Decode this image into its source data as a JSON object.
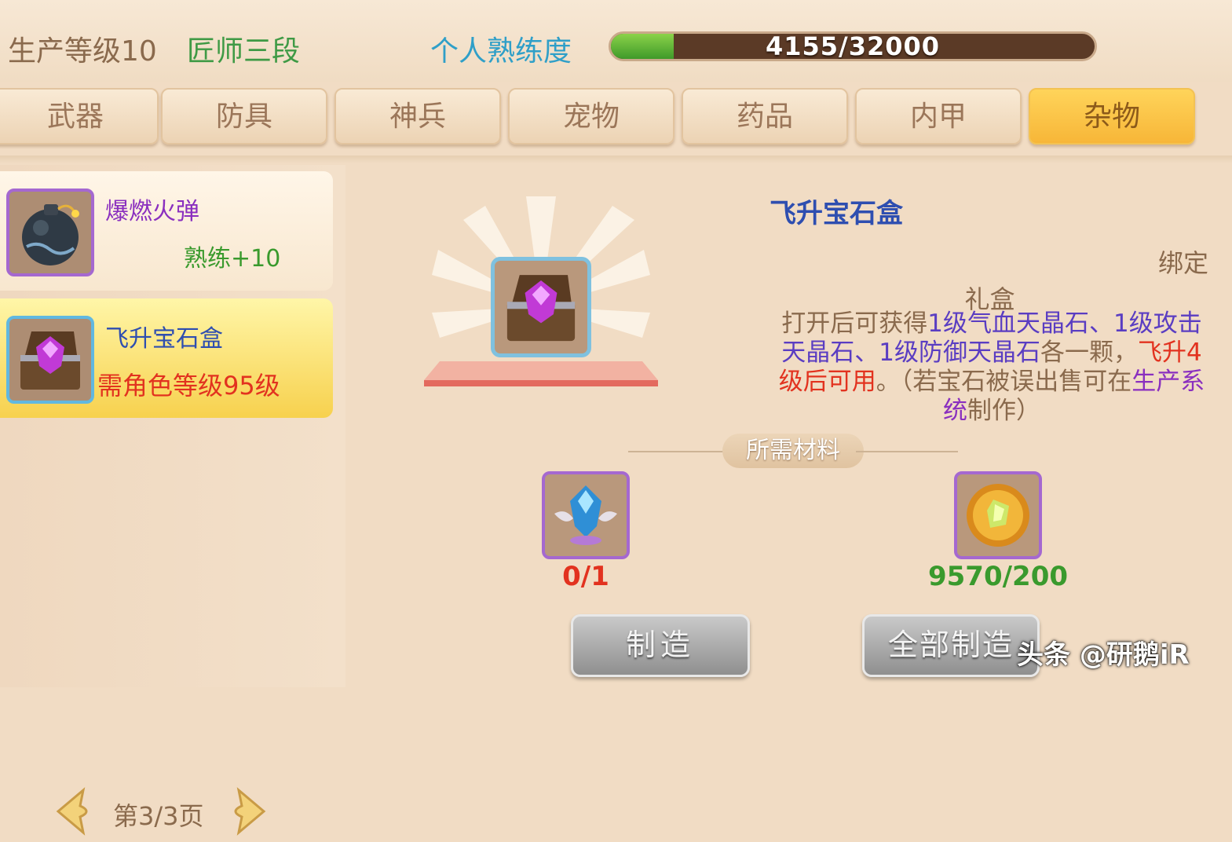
{
  "header": {
    "production_level": "生产等级10",
    "rank": "匠师三段",
    "proficiency_label": "个人熟练度",
    "proficiency_text": "4155/32000",
    "proficiency_fraction": 0.13
  },
  "tabs": [
    {
      "label": "武器"
    },
    {
      "label": "防具"
    },
    {
      "label": "神兵"
    },
    {
      "label": "宠物"
    },
    {
      "label": "药品"
    },
    {
      "label": "内甲"
    },
    {
      "label": "杂物",
      "active": true
    }
  ],
  "recipes": [
    {
      "name": "爆燃火弹",
      "proficiency": "熟练+10",
      "icon": "fire-bomb-icon"
    },
    {
      "name": "飞升宝石盒",
      "requirement": "需角色等级95级",
      "icon": "gem-box-icon",
      "selected": true
    }
  ],
  "pager": {
    "text": "第3/3页"
  },
  "detail": {
    "title": "飞升宝石盒",
    "bind": "绑定",
    "category": "礼盒",
    "desc_1": "打开后可获得",
    "desc_2": "1级气血天晶石、1级攻击天晶石、1级防御天晶石",
    "desc_3": "各一颗，",
    "desc_4": "飞升4级后可用",
    "desc_5": "。（若宝石被误出售可在",
    "desc_6": "生产系统",
    "desc_7": "制作）"
  },
  "materials": {
    "label": "所需材料",
    "items": [
      {
        "icon": "winged-crystal-icon",
        "count": "0/1"
      },
      {
        "icon": "gold-gem-coin-icon",
        "count": "9570/200"
      }
    ]
  },
  "buttons": {
    "make": "制造",
    "make_all": "全部制造"
  },
  "watermark": "头条 @研鹅iR",
  "colors": {
    "accent_tab": "#f7b638",
    "progress": "#3f9a2a",
    "insufficient": "#e2321f",
    "sufficient": "#3a9a2d"
  }
}
